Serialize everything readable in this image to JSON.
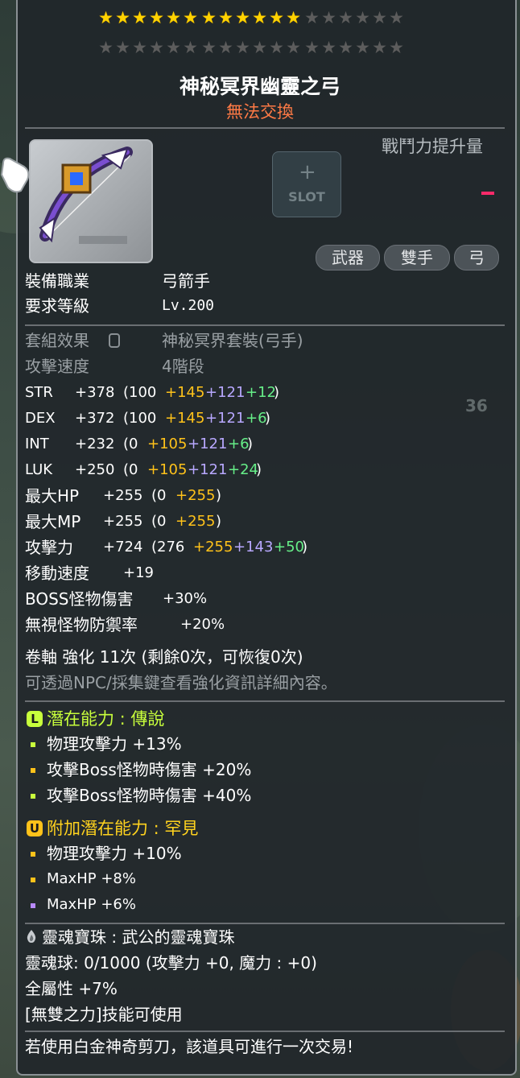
{
  "stars": {
    "filled": 12,
    "total": 18,
    "groups_per_row": 3,
    "per_group": 6
  },
  "item": {
    "name": "神秘冥界幽靈之弓",
    "trade_status": "無法交換",
    "combat_power_label": "戰鬥力提升量",
    "combat_power_value": "-",
    "slot_label": "SLOT",
    "tags": [
      "武器",
      "雙手",
      "弓"
    ]
  },
  "requirements": {
    "job_label": "裝備職業",
    "job_value": "弓箭手",
    "level_label": "要求等級",
    "level_value": "Lv.200"
  },
  "set": {
    "set_label": "套組效果",
    "set_value": "神秘冥界套裝(弓手)",
    "speed_label": "攻擊速度",
    "speed_value": "4階段"
  },
  "stats": [
    {
      "name": "STR",
      "total": "+378",
      "open": "(100",
      "a": "+145",
      "b": "+121",
      "c": "+12",
      "close": ")"
    },
    {
      "name": "DEX",
      "total": "+372",
      "open": "(100",
      "a": "+145",
      "b": "+121",
      "c": "+6",
      "close": ")"
    },
    {
      "name": "INT",
      "total": "+232",
      "open": "(0",
      "a": "+105",
      "b": "+121",
      "c": "+6",
      "close": ")"
    },
    {
      "name": "LUK",
      "total": "+250",
      "open": "(0",
      "a": "+105",
      "b": "+121",
      "c": "+24",
      "close": ")"
    },
    {
      "name": "最大HP",
      "total": "+255",
      "open": "(0",
      "a": "+255",
      "b": "",
      "c": "",
      "close": ")"
    },
    {
      "name": "最大MP",
      "total": "+255",
      "open": "(0",
      "a": "+255",
      "b": "",
      "c": "",
      "close": ")"
    },
    {
      "name": "攻擊力",
      "total": "+724",
      "open": "(276",
      "a": "+255",
      "b": "+143",
      "c": "+50",
      "close": ")"
    }
  ],
  "extra_stats": [
    {
      "name": "移動速度",
      "value": "+19"
    },
    {
      "name": "BOSS怪物傷害",
      "value": "+30%"
    },
    {
      "name": "無視怪物防禦率",
      "value": "+20%"
    }
  ],
  "scroll": {
    "line": "卷軸 強化 11次 (剩餘0次，可恢復0次)",
    "hint": "可透過NPC/採集鍵查看強化資訊詳細內容。"
  },
  "potential": {
    "badge": "L",
    "title": "潛在能力 : 傳說",
    "lines": [
      "物理攻擊力 +13%",
      "攻擊Boss怪物時傷害 +20%",
      "攻擊Boss怪物時傷害 +40%"
    ]
  },
  "additional": {
    "badge": "U",
    "title": "附加潛在能力 : 罕見",
    "lines": [
      "物理攻擊力 +10%",
      "MaxHP +8%",
      "MaxHP +6%"
    ]
  },
  "soul": {
    "title": "靈魂寶珠 : 武公的靈魂寶珠",
    "orb": "靈魂球: 0/1000 (攻擊力 +0, 魔力 : +0)",
    "all_stat": "全屬性 +7%",
    "skill": "[無雙之力]技能可使用",
    "scissors": "若使用白金神奇剪刀，該道具可進行一次交易!"
  },
  "colors": {
    "star_on": "#ffd200",
    "star_off": "#5c5c5c",
    "trade": "#ff7a45",
    "legend": "#c8ff3c",
    "rare": "#ffd21e",
    "bonus_gold": "#ffc21a",
    "bonus_blue": "#b8a8ff",
    "bonus_green": "#66ee88"
  },
  "background_numbers": [
    "36"
  ]
}
